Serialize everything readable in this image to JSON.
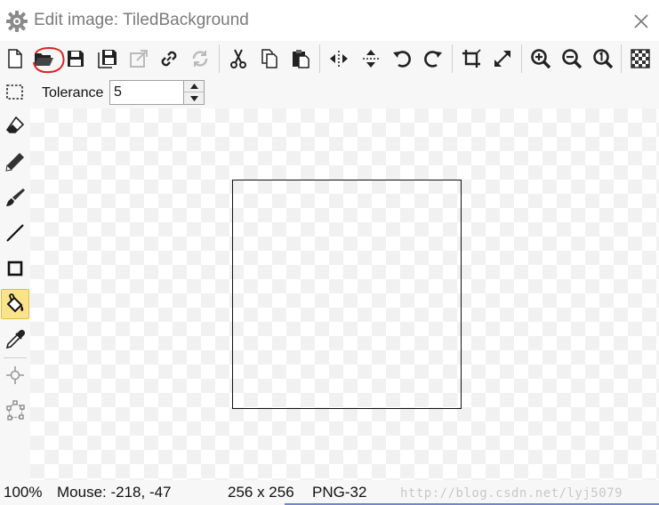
{
  "window": {
    "title": "Edit image: TiledBackground",
    "icon": "gear-icon",
    "close_icon": "close-icon"
  },
  "toolbar": {
    "buttons": [
      {
        "id": "new",
        "icon": "new-file-icon"
      },
      {
        "id": "open",
        "icon": "open-folder-icon",
        "highlighted": true
      },
      {
        "id": "save",
        "icon": "save-icon"
      },
      {
        "id": "save-copy",
        "icon": "save-copy-icon"
      },
      {
        "id": "export",
        "icon": "export-icon",
        "disabled": true
      },
      {
        "id": "link",
        "icon": "link-icon"
      },
      {
        "id": "reload",
        "icon": "reload-icon",
        "disabled": true
      },
      {
        "id": "cut",
        "icon": "cut-icon"
      },
      {
        "id": "copy",
        "icon": "copy-icon"
      },
      {
        "id": "paste",
        "icon": "paste-icon"
      },
      {
        "id": "flip-horizontal",
        "icon": "flip-horizontal-icon"
      },
      {
        "id": "flip-vertical",
        "icon": "flip-vertical-icon"
      },
      {
        "id": "rotate-left",
        "icon": "rotate-left-icon"
      },
      {
        "id": "rotate-right",
        "icon": "rotate-right-icon"
      },
      {
        "id": "crop",
        "icon": "crop-icon"
      },
      {
        "id": "resize",
        "icon": "resize-icon"
      },
      {
        "id": "zoom-in",
        "icon": "zoom-in-icon"
      },
      {
        "id": "zoom-out",
        "icon": "zoom-out-icon"
      },
      {
        "id": "zoom-actual",
        "icon": "zoom-actual-icon"
      },
      {
        "id": "transparency",
        "icon": "transparency-icon"
      }
    ]
  },
  "options": {
    "tolerance_label": "Tolerance",
    "tolerance_value": "5"
  },
  "tools": [
    {
      "id": "eraser",
      "icon": "eraser-icon"
    },
    {
      "id": "pencil",
      "icon": "pencil-icon"
    },
    {
      "id": "brush",
      "icon": "brush-icon"
    },
    {
      "id": "line",
      "icon": "line-icon"
    },
    {
      "id": "rectangle",
      "icon": "rectangle-icon"
    },
    {
      "id": "fill",
      "icon": "paint-bucket-icon",
      "active": true
    },
    {
      "id": "color-picker",
      "icon": "eyedropper-icon"
    },
    {
      "id": "origin",
      "icon": "crosshair-icon"
    },
    {
      "id": "polygon",
      "icon": "polygon-icon"
    }
  ],
  "canvas": {
    "image_width": 256,
    "image_height": 256
  },
  "status": {
    "zoom": "100%",
    "mouse": "Mouse: -218, -47",
    "size": "256 x 256",
    "format": "PNG-32",
    "watermark": "http://blog.csdn.net/lyj5079"
  },
  "colors": {
    "highlight_circle": "#e02020",
    "active_tool": "#fbe389",
    "toolbar_bg": "#f7f7f7"
  }
}
